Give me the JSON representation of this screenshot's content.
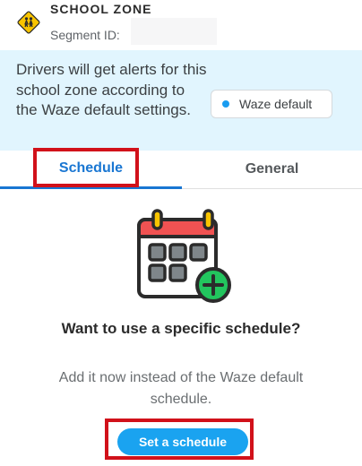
{
  "header": {
    "title": "SCHOOL ZONE",
    "segment_label": "Segment ID:",
    "segment_value": "",
    "icon": "school-zone-icon"
  },
  "info": {
    "text": "Drivers will get alerts for this school zone according to the Waze default settings.",
    "pill_label": "Waze default",
    "pill_dot_color": "#1a9cf0"
  },
  "tabs": [
    {
      "label": "Schedule",
      "active": true
    },
    {
      "label": "General",
      "active": false
    }
  ],
  "empty_state": {
    "icon": "calendar-add-icon",
    "title": "Want to use a specific schedule?",
    "subtitle": "Add it now instead of the Waze default schedule.",
    "button_label": "Set a schedule"
  },
  "colors": {
    "accent": "#1976d2",
    "button": "#1aa3f0",
    "highlight": "#d1111a",
    "info_bg": "#e1f5fe"
  }
}
